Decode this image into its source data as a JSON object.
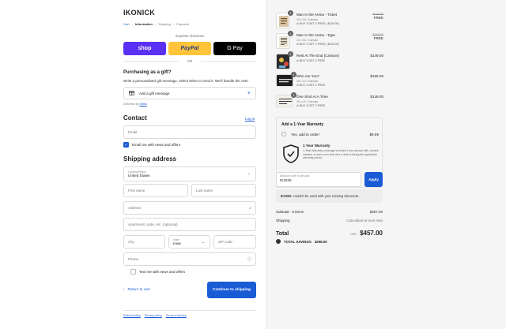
{
  "store": {
    "brand": "IKONICK"
  },
  "breadcrumbs": [
    {
      "label": "Cart"
    },
    {
      "label": "Information"
    },
    {
      "label": "Shipping"
    },
    {
      "label": "Payment"
    }
  ],
  "express": {
    "label": "Express checkout",
    "buttons": [
      {
        "label": "shop",
        "color": "#5a31f4"
      },
      {
        "label": "PayPal",
        "color": "#ffc439"
      },
      {
        "label": "G Pay",
        "color": "#000000"
      }
    ],
    "or": "OR"
  },
  "gift": {
    "heading": "Purchasing as a gift?",
    "subtext": "Write a personalised gift message, select when to send it. We'll handle the rest!",
    "add_label": "Add a gift message",
    "powered_prefix": "Delivered by",
    "powered_link": "Gifted"
  },
  "contact": {
    "heading": "Contact",
    "login_link": "Log in",
    "email_placeholder": "Email",
    "news_label": "Email me with news and offers",
    "news_checked": true
  },
  "shipping": {
    "heading": "Shipping address",
    "country_label": "Country/Region",
    "country_value": "United States",
    "first_name": "First name",
    "last_name": "Last name",
    "address": "Address",
    "apartment": "Apartment, suite, etc. (optional)",
    "city": "City",
    "state_label": "State",
    "state_value": "Iowa",
    "zip": "ZIP code",
    "phone": "Phone",
    "text_label": "Text me with news and offers",
    "text_checked": false
  },
  "actions": {
    "back": "Return to cart",
    "continue": "Continue to shipping"
  },
  "footer_links": [
    "Refund policy",
    "Privacy policy",
    "Terms of service"
  ],
  "cart": {
    "items": [
      {
        "qty": "1",
        "name": "Man In the Arena - Ticket",
        "size": "12 x 16 / Canvas",
        "promo": "BUY 3 GET 2 FREE (-$149.00)",
        "compare": "$149.00",
        "price": "FREE"
      },
      {
        "qty": "1",
        "name": "Man In the Arena - Type",
        "size": "12 x 16 / Canvas",
        "promo": "BUY 3 GET 2 FREE (-$149.00)",
        "compare": "$149.00",
        "price": "FREE"
      },
      {
        "qty": "1",
        "name": "Rest At The End (Cartoon)",
        "size": "",
        "promo": "BUY 3 GET 2 FREE",
        "compare": "",
        "price": "$149.00"
      },
      {
        "qty": "1",
        "name": "Who Are You?",
        "size": "16 x 12 / Canvas",
        "promo": "BUY 3 GET 2 FREE",
        "compare": "",
        "price": "$159.00"
      },
      {
        "qty": "1",
        "name": "One Shot At A Time",
        "size": "20 x 16 / Canvas",
        "promo": "BUY 3 GET 2 FREE",
        "compare": "",
        "price": "$149.00"
      }
    ]
  },
  "warranty": {
    "heading": "Add a 1-Year Warranty",
    "option_label": "Yes, add to order!",
    "option_price": "$9.99",
    "title": "1 Year Warranty",
    "description": "1-Year Warranty coverage includes if any canvas falls, breaks, creases or tears over time due a defect during the applicable warranty period."
  },
  "discount": {
    "label": "Discount code or gift card",
    "value": "IK2025",
    "apply": "Apply",
    "error_code": "IK2025",
    "error_text": "couldn't be used with your existing discounts."
  },
  "summary": {
    "subtotal_label": "Subtotal · 5 items",
    "subtotal_value": "$457.00",
    "shipping_label": "Shipping",
    "shipping_value": "Calculated at next step",
    "total_label": "Total",
    "currency": "USD",
    "total_value": "$457.00",
    "savings_label": "TOTAL SAVINGS",
    "savings_value": "$298.00"
  }
}
